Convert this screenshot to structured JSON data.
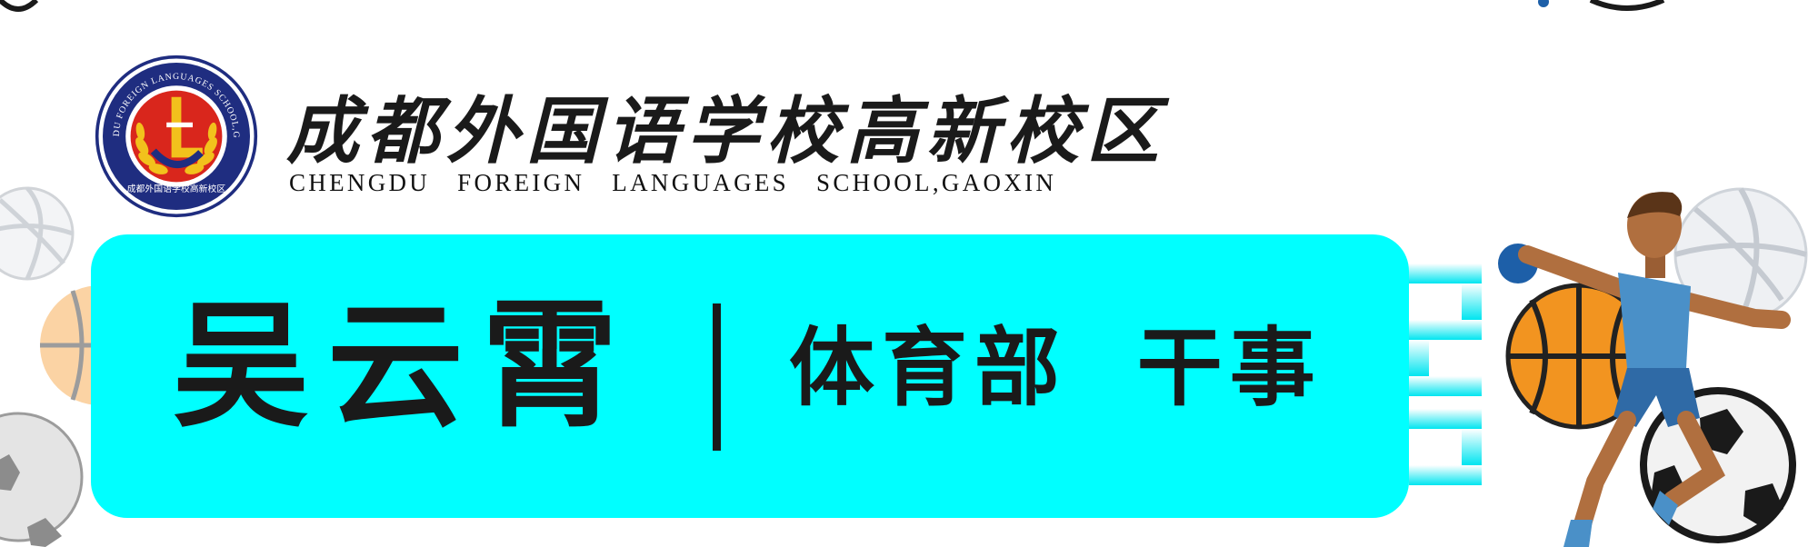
{
  "header": {
    "school_name_cn": "成都外国语学校高新校区",
    "school_name_en": "CHENGDU FOREIGN LANGUAGES SCHOOL,GAOXIN",
    "logo": {
      "ring_text": "CHENGDU FOREIGN LANGUAGES SCHOOL,GAOXIN",
      "bottom_text": "成都外国语学校高新校区"
    }
  },
  "banner": {
    "name": "吴云霄",
    "role": "体育部 干事"
  },
  "colors": {
    "banner": "#00ffff",
    "logo_navy": "#1f2d80",
    "logo_red": "#d9261c",
    "logo_gold": "#f2c11c",
    "text": "#1a1a1a"
  },
  "decorations": [
    "volleyball-icon",
    "basketball-icon",
    "soccer-ball-icon",
    "handball-player-icon",
    "gradient-stripes"
  ]
}
